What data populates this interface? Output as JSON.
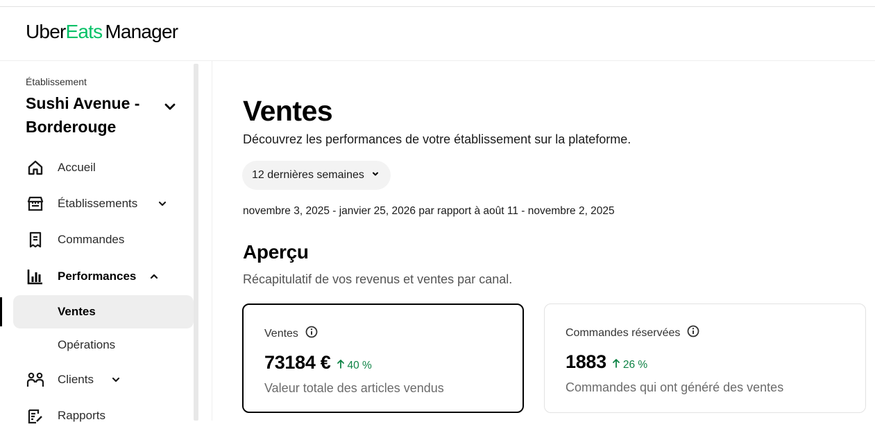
{
  "header": {
    "logo_part1": "Uber",
    "logo_part2": "Eats",
    "logo_part3": "Manager",
    "brand_green": "#06c167"
  },
  "sidebar": {
    "store_label": "Établissement",
    "store_name": "Sushi Avenue - Borderouge",
    "nav": [
      {
        "label": "Accueil",
        "icon": "home-icon"
      },
      {
        "label": "Établissements",
        "icon": "store-icon"
      },
      {
        "label": "Commandes",
        "icon": "receipt-icon"
      },
      {
        "label": "Performances",
        "icon": "bar-chart-icon"
      },
      {
        "label": "Clients",
        "icon": "people-icon"
      },
      {
        "label": "Rapports",
        "icon": "report-icon"
      }
    ],
    "sub": [
      {
        "label": "Ventes",
        "active": true
      },
      {
        "label": "Opérations",
        "active": false
      }
    ]
  },
  "main": {
    "title": "Ventes",
    "description": "Découvrez les performances de votre établissement sur la plateforme.",
    "period_label": "12 dernières semaines",
    "range_text": "novembre 3, 2025 - janvier 25, 2026 par rapport à août 11 - novembre 2, 2025",
    "overview_title": "Aperçu",
    "overview_subtitle": "Récapitulatif de vos revenus et ventes par canal.",
    "cards": [
      {
        "title": "Ventes",
        "value": "73184 €",
        "delta": "40 %",
        "description": "Valeur totale des articles vendus"
      },
      {
        "title": "Commandes réservées",
        "value": "1883",
        "delta": "26 %",
        "description": "Commandes qui ont généré des ventes"
      }
    ],
    "positive_color": "#0e8345"
  }
}
